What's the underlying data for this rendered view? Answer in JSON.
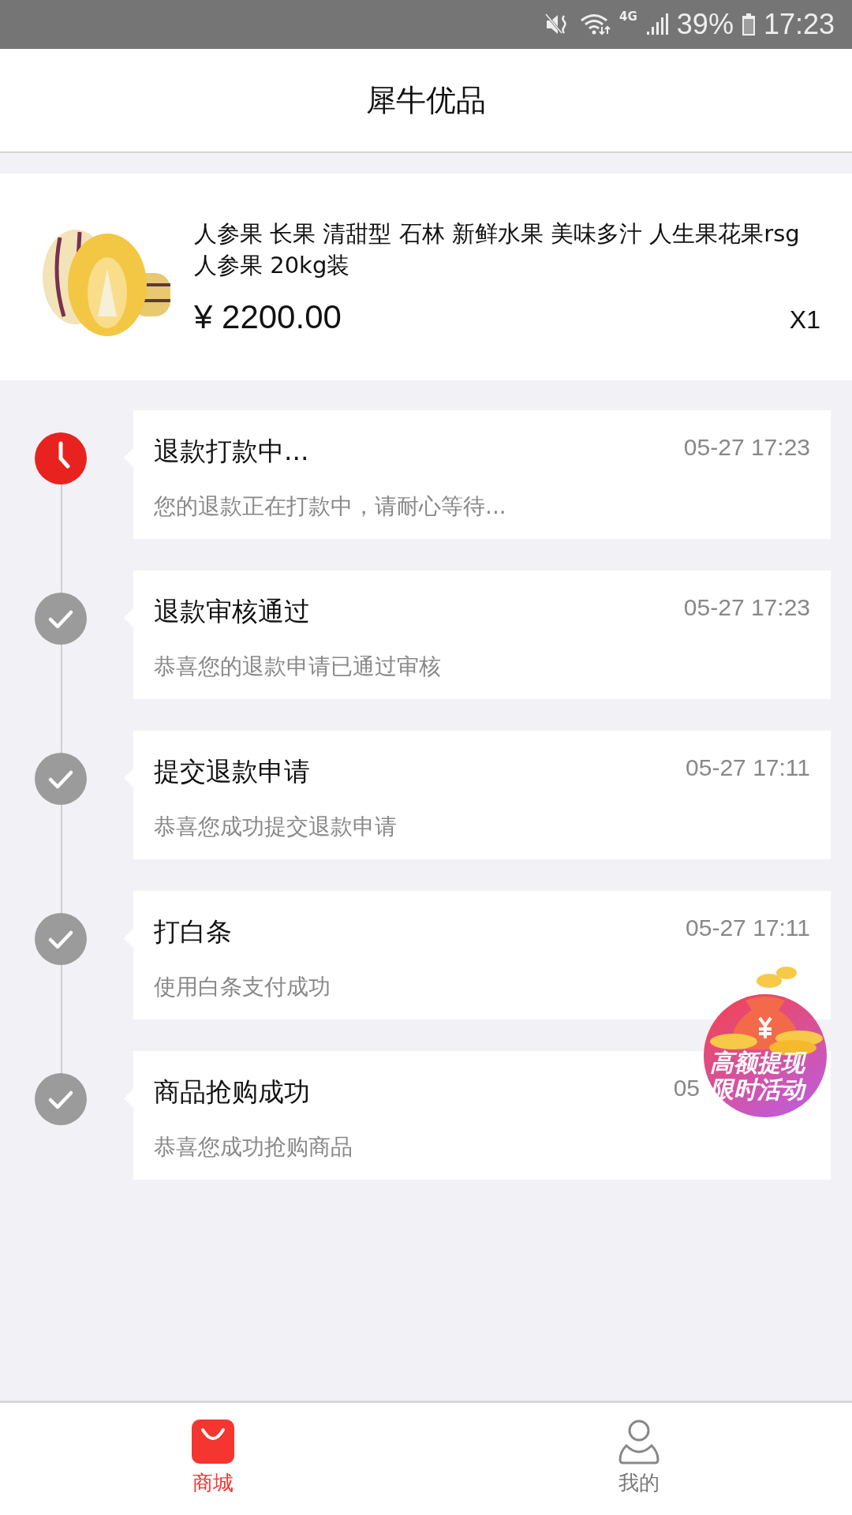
{
  "status_bar": {
    "battery": "39%",
    "time": "17:23",
    "network": "4G"
  },
  "header": {
    "title": "犀牛优品"
  },
  "product": {
    "name": "人参果 长果 清甜型 石林 新鲜水果 美味多汁 人生果花果rsg 人参果 20kg装",
    "price": "¥ 2200.00",
    "quantity": "X1"
  },
  "timeline": [
    {
      "kind": "in_progress",
      "title": "退款打款中...",
      "time": "05-27 17:23",
      "detail": "您的退款正在打款中，请耐心等待..."
    },
    {
      "kind": "done",
      "title": "退款审核通过",
      "time": "05-27 17:23",
      "detail": "恭喜您的退款申请已通过审核"
    },
    {
      "kind": "done",
      "title": "提交退款申请",
      "time": "05-27 17:11",
      "detail": "恭喜您成功提交退款申请"
    },
    {
      "kind": "done",
      "title": "打白条",
      "time": "05-27 17:11",
      "detail": "使用白条支付成功"
    },
    {
      "kind": "done",
      "title": "商品抢购成功",
      "time": "05",
      "detail": "恭喜您成功抢购商品"
    }
  ],
  "promo_badge": {
    "lines": [
      "高额提现",
      "限时活动"
    ]
  },
  "tabs": [
    {
      "label": "商城",
      "kind": "shop",
      "selected": true
    },
    {
      "label": "我的",
      "kind": "profile",
      "selected": false
    }
  ]
}
